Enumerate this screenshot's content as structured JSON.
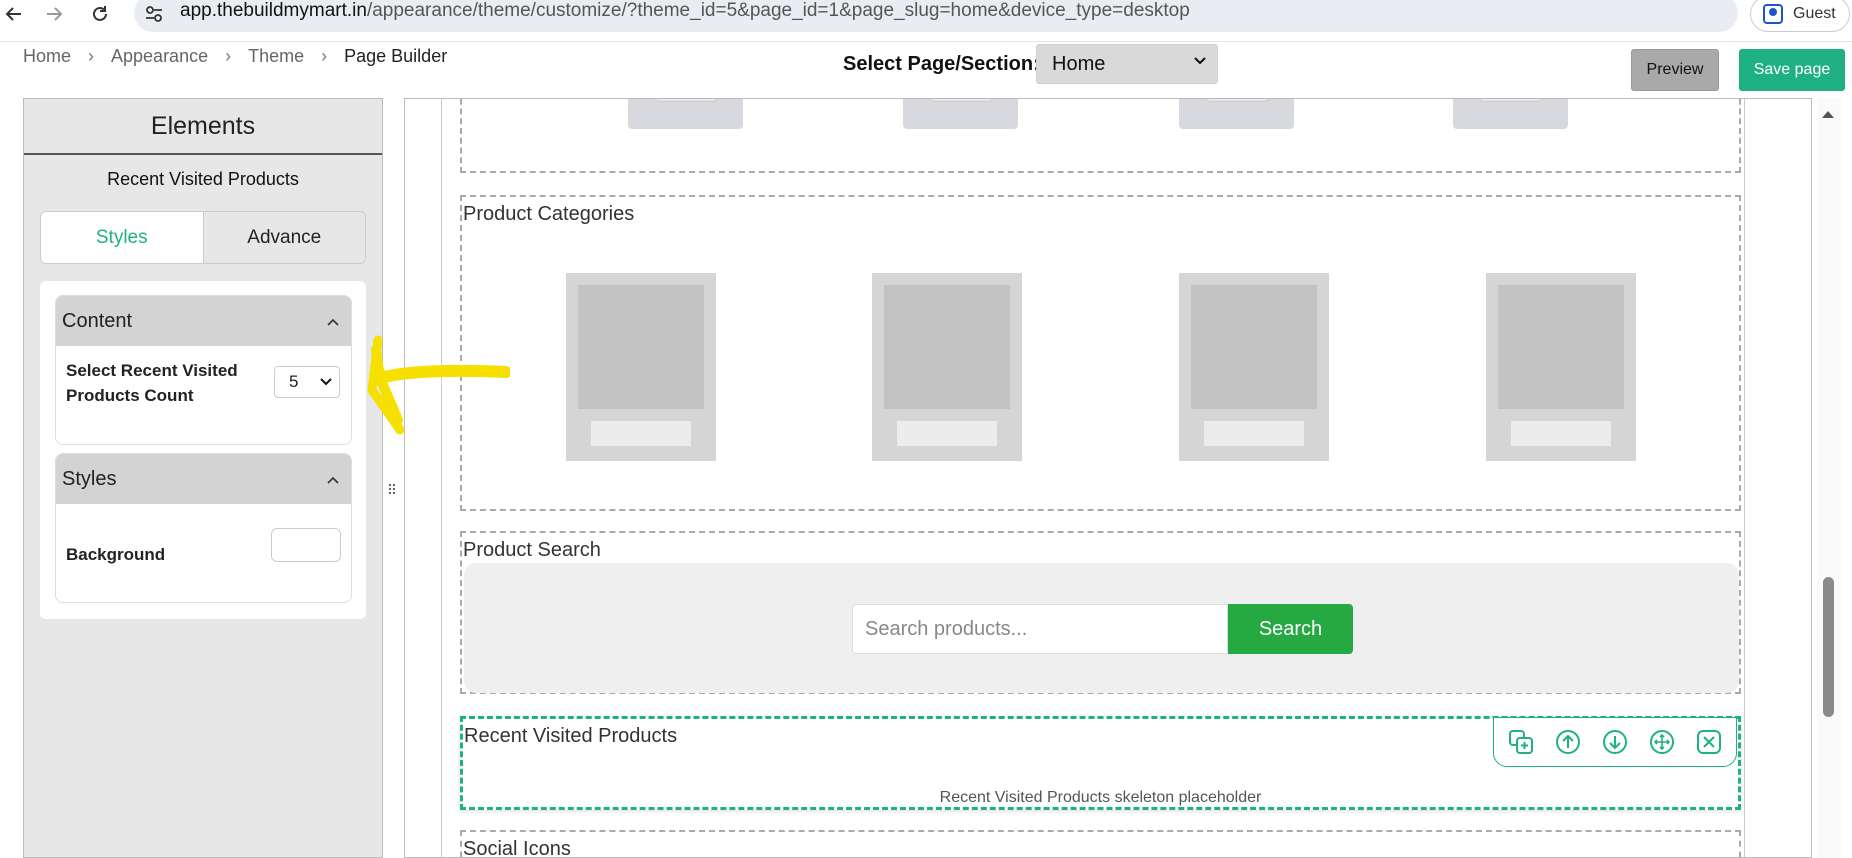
{
  "browser": {
    "url_host": "app.thebuildmymart.in",
    "url_path": "/appearance/theme/customize/?theme_id=5&page_id=1&page_slug=home&device_type=desktop",
    "profile_label": "Guest"
  },
  "breadcrumb": {
    "items": [
      "Home",
      "Appearance",
      "Theme",
      "Page Builder"
    ]
  },
  "header": {
    "select_label": "Select Page/Section:",
    "selected_page": "Home",
    "preview_label": "Preview",
    "save_label": "Save page"
  },
  "left_panel": {
    "title": "Elements",
    "subtitle": "Recent Visited Products",
    "tabs": [
      {
        "label": "Styles",
        "active": true
      },
      {
        "label": "Advance",
        "active": false
      }
    ],
    "content_section": {
      "title": "Content",
      "field_label": "Select Recent Visited Products Count",
      "field_value": "5"
    },
    "styles_section": {
      "title": "Styles",
      "field_label": "Background",
      "field_value": "#ffffff"
    }
  },
  "canvas": {
    "sections": [
      {
        "title": ""
      },
      {
        "title": "Product Categories"
      },
      {
        "title": "Product Search",
        "search_placeholder": "Search products...",
        "search_button": "Search"
      },
      {
        "title": "Recent Visited Products",
        "placeholder": "Recent Visited Products skeleton placeholder",
        "selected": true
      },
      {
        "title": "Social Icons"
      }
    ],
    "toolbar_icons": [
      "duplicate-icon",
      "move-up-icon",
      "move-down-icon",
      "drag-move-icon",
      "delete-icon"
    ]
  },
  "colors": {
    "accent": "#1fb183",
    "search_button": "#26a842",
    "preview_button": "#a9a9a9",
    "annotation": "#f5e000"
  }
}
